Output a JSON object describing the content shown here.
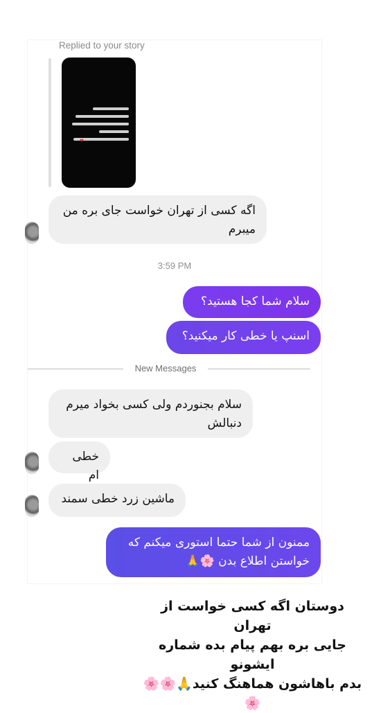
{
  "thread": {
    "replied_caption": "Replied to your story",
    "story_thumbnail": {
      "text_lines": 5,
      "heart": "❤"
    },
    "messages_before": [
      {
        "side": "in",
        "text": "اگه کسی از تهران خواست جای بره من میبرم"
      }
    ],
    "time_separator": "3:59 PM",
    "outgoing": [
      {
        "text": "سلام شما کجا هستید؟"
      },
      {
        "text": "اسنپ یا خطی کار میکنید؟"
      }
    ],
    "new_messages_label": "New Messages",
    "incoming_after": [
      {
        "text": "سلام بجنوردم ولی کسی بخواد میرم دنبالش"
      },
      {
        "text": "خطی ام"
      },
      {
        "text": "ماشین زرد خطی سمند"
      }
    ],
    "last_outgoing": {
      "text": "ممنون از شما حتما استوری میکنم که خواستن اطلاع بدن 🌸🙏"
    }
  },
  "caption_overlay": {
    "text": "دوستان اگه کسی خواست از تهران\nجایی بره بهم پیام بده شماره ایشونو\nبدم باهاشون هماهنگ کنید🙏🌸🌸🌸"
  },
  "colors": {
    "incoming_bubble": "#efefef",
    "outgoing_gradient": [
      "#7a3df0",
      "#5a4fe6"
    ],
    "meta_text": "#8e8e8e"
  }
}
